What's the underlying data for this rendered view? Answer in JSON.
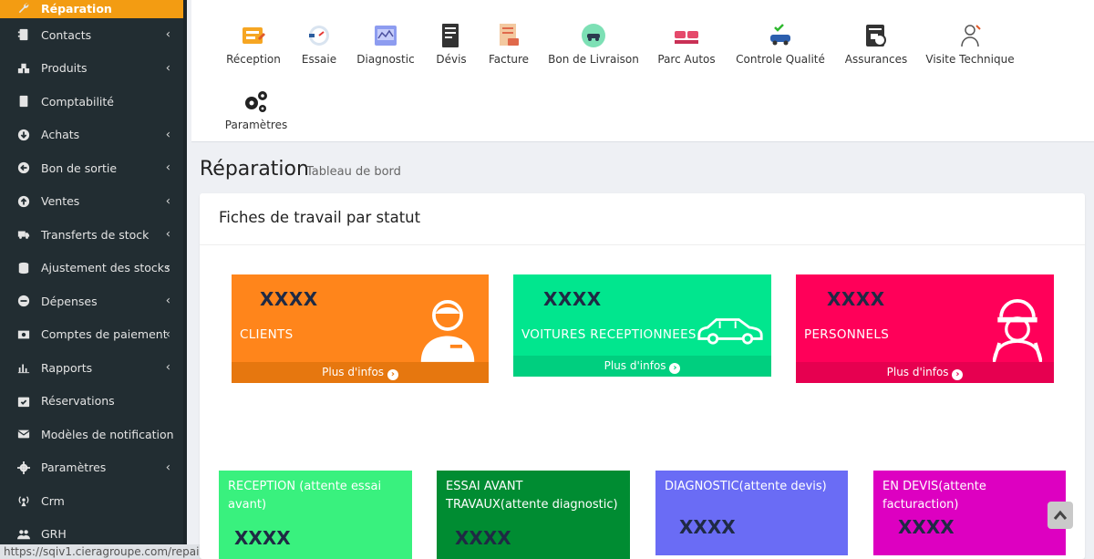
{
  "sidebar": {
    "items": [
      {
        "label": "Réparation",
        "icon": "wrench-icon",
        "chevron": false,
        "active": true
      },
      {
        "label": "Contacts",
        "icon": "address-book-icon",
        "chevron": true
      },
      {
        "label": "Produits",
        "icon": "cubes-icon",
        "chevron": true
      },
      {
        "label": "Comptabilité",
        "icon": "book-icon",
        "chevron": false
      },
      {
        "label": "Achats",
        "icon": "arrow-circle-down-icon",
        "chevron": true
      },
      {
        "label": "Bon de sortie",
        "icon": "arrow-circle-left-icon",
        "chevron": true
      },
      {
        "label": "Ventes",
        "icon": "arrow-circle-up-icon",
        "chevron": true
      },
      {
        "label": "Transferts de stock",
        "icon": "truck-icon",
        "chevron": true
      },
      {
        "label": "Ajustement des stocks",
        "icon": "database-icon",
        "chevron": true
      },
      {
        "label": "Dépenses",
        "icon": "minus-circle-icon",
        "chevron": true
      },
      {
        "label": "Comptes de paiement",
        "icon": "money-icon",
        "chevron": true
      },
      {
        "label": "Rapports",
        "icon": "bar-chart-icon",
        "chevron": true
      },
      {
        "label": "Réservations",
        "icon": "calendar-check-icon",
        "chevron": false
      },
      {
        "label": "Modèles de notification",
        "icon": "envelope-icon",
        "chevron": false
      },
      {
        "label": "Paramètres",
        "icon": "cog-icon",
        "chevron": true
      },
      {
        "label": "Crm",
        "icon": "broadcast-icon",
        "chevron": false
      },
      {
        "label": "GRH",
        "icon": "users-icon",
        "chevron": false
      }
    ]
  },
  "statusbar": {
    "url": "https://sqiv1.cieragroupe.com/repair/re"
  },
  "toolbar": {
    "items": [
      {
        "label": "Réception",
        "icon": "reception-icon"
      },
      {
        "label": "Essaie",
        "icon": "test-gauge-icon"
      },
      {
        "label": "Diagnostic",
        "icon": "diagnostic-icon"
      },
      {
        "label": "Dévis",
        "icon": "quote-document-icon"
      },
      {
        "label": "Facture",
        "icon": "invoice-icon"
      },
      {
        "label": "Bon de Livraison",
        "icon": "delivery-car-icon"
      },
      {
        "label": "Parc Autos",
        "icon": "car-park-icon"
      },
      {
        "label": "Controle Qualité",
        "icon": "quality-car-icon"
      },
      {
        "label": "Assurances",
        "icon": "insurance-icon"
      },
      {
        "label": "Visite Technique",
        "icon": "technician-icon"
      },
      {
        "label": "Paramètres",
        "icon": "gears-icon"
      }
    ]
  },
  "page": {
    "title": "Réparation",
    "subtitle": "Tableau de bord"
  },
  "card": {
    "title": "Fiches de travail par statut"
  },
  "stats_top": [
    {
      "value": "XXXX",
      "label": "CLIENTS",
      "footer": "Plus d'infos",
      "color": "#ff851b",
      "footer_color": "#e6770f",
      "icon": "client-person-icon"
    },
    {
      "value": "XXXX",
      "label": "VOITURES RECEPTIONNEES",
      "footer": "Plus d'infos",
      "color": "#01e68e",
      "footer_color": "#00cf7f",
      "icon": "car-outline-icon"
    },
    {
      "value": "XXXX",
      "label": "PERSONNELS",
      "footer": "Plus d'infos",
      "color": "#ff0059",
      "footer_color": "#e60050",
      "icon": "mechanic-icon"
    }
  ],
  "stats_bottom": [
    {
      "label": "RECEPTION (attente essai avant)",
      "value": "XXXX",
      "color": "#39f17e"
    },
    {
      "label": "ESSAI AVANT TRAVAUX(attente diagnostic)",
      "value": "XXXX",
      "color": "#008c32"
    },
    {
      "label": "DIAGNOSTIC(attente devis)",
      "value": "XXXX",
      "color": "#6a6cf5"
    },
    {
      "label": "EN DEVIS(attente facturaction)",
      "value": "XXXX",
      "color": "#dd00c1"
    }
  ],
  "scroll_top": {
    "icon": "chevron-up-icon"
  }
}
